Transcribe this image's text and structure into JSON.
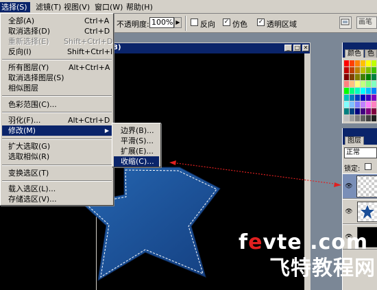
{
  "menubar": {
    "items": [
      {
        "label": "选择(S)",
        "active": true
      },
      {
        "label": "滤镜(T)"
      },
      {
        "label": "视图(V)"
      },
      {
        "label": "窗口(W)"
      },
      {
        "label": "帮助(H)"
      }
    ]
  },
  "options": {
    "opacity_label": "不透明度:",
    "opacity_value": "100%",
    "reverse_label": "反向",
    "reverse_checked": false,
    "dither_label": "仿色",
    "dither_checked": true,
    "transparency_label": "透明区域",
    "transparency_checked": true,
    "truncated_button": "画笔"
  },
  "select_menu": {
    "items": [
      {
        "label": "全部(A)",
        "shortcut": "Ctrl+A"
      },
      {
        "label": "取消选择(D)",
        "shortcut": "Ctrl+D"
      },
      {
        "label": "重新选择(E)",
        "shortcut": "Shift+Ctrl+D",
        "disabled": true
      },
      {
        "label": "反向(I)",
        "shortcut": "Shift+Ctrl+I"
      },
      {
        "label": "所有图层(Y)",
        "shortcut": "Alt+Ctrl+A"
      },
      {
        "label": "取消选择图层(S)",
        "shortcut": ""
      },
      {
        "label": "相似图层",
        "shortcut": ""
      },
      {
        "label": "色彩范围(C)...",
        "shortcut": ""
      },
      {
        "label": "羽化(F)...",
        "shortcut": "Alt+Ctrl+D"
      },
      {
        "label": "修改(M)",
        "shortcut": "",
        "highlighted": true,
        "submenu": true
      },
      {
        "label": "扩大选取(G)",
        "shortcut": ""
      },
      {
        "label": "选取相似(R)",
        "shortcut": ""
      },
      {
        "label": "变换选区(T)",
        "shortcut": ""
      },
      {
        "label": "载入选区(L)...",
        "shortcut": ""
      },
      {
        "label": "存储选区(V)...",
        "shortcut": ""
      }
    ]
  },
  "modify_submenu": {
    "items": [
      {
        "label": "边界(B)..."
      },
      {
        "label": "平滑(S)..."
      },
      {
        "label": "扩展(E)..."
      },
      {
        "label": "收缩(C)...",
        "highlighted": true
      }
    ]
  },
  "document": {
    "title_suffix": "3)"
  },
  "swatches": {
    "tabs": [
      "颜色",
      "色"
    ]
  },
  "layers": {
    "tab_label": "图层",
    "blend_mode": "正常",
    "lock_label": "锁定:"
  },
  "watermark": {
    "line1_pre": "f",
    "line1_e": "e",
    "line1_post": "vte .com",
    "line2": "飞特教程网"
  },
  "colors": {
    "accent": "#0a246a",
    "star_fill": "#1a4e98",
    "arrow": "#e02020"
  }
}
